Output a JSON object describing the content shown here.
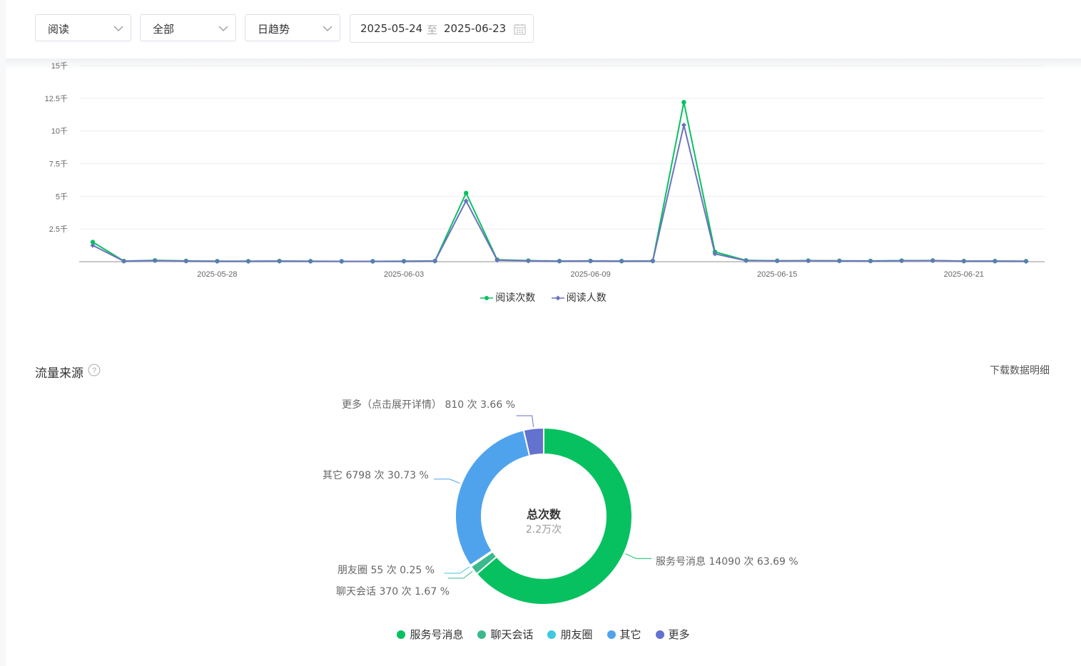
{
  "filters": {
    "metric": "阅读",
    "scope": "全部",
    "granularity": "日趋势",
    "date_start": "2025-05-24",
    "date_sep": "至",
    "date_end": "2025-06-23"
  },
  "trend_legend": [
    {
      "label": "阅读次数",
      "color": "#07c160"
    },
    {
      "label": "阅读人数",
      "color": "#6b72bd"
    }
  ],
  "chart_data": [
    {
      "type": "line",
      "x_start": "2025-05-24",
      "x_end": "2025-06-23",
      "xticks": [
        "2025-05-28",
        "2025-06-03",
        "2025-06-09",
        "2025-06-15",
        "2025-06-21"
      ],
      "yticks": [
        "2.5千",
        "5千",
        "7.5千",
        "10千",
        "12.5千",
        "15千"
      ],
      "ylim": [
        0,
        15000
      ],
      "grid": true,
      "legend": "bottom",
      "series": [
        {
          "name": "阅读次数",
          "color": "#07c160",
          "values": [
            1500,
            50,
            100,
            60,
            40,
            40,
            50,
            40,
            30,
            30,
            40,
            60,
            5250,
            150,
            80,
            50,
            60,
            50,
            60,
            12200,
            750,
            100,
            70,
            80,
            70,
            60,
            80,
            90,
            50,
            50,
            40
          ]
        },
        {
          "name": "阅读人数",
          "color": "#6b72bd",
          "values": [
            1250,
            40,
            80,
            50,
            30,
            30,
            40,
            30,
            25,
            25,
            30,
            50,
            4650,
            120,
            60,
            40,
            50,
            40,
            50,
            10450,
            600,
            80,
            60,
            70,
            60,
            50,
            70,
            80,
            40,
            40,
            30
          ]
        }
      ]
    },
    {
      "type": "pie",
      "title": "总次数",
      "total_label": "2.2万次",
      "legend": "bottom",
      "slices": [
        {
          "name": "服务号消息",
          "value": 14090,
          "percent": 63.69,
          "color": "#07c160"
        },
        {
          "name": "聊天会话",
          "value": 370,
          "percent": 1.67,
          "color": "#3cb98b"
        },
        {
          "name": "朋友圈",
          "value": 55,
          "percent": 0.25,
          "color": "#3ec9e0"
        },
        {
          "name": "其它",
          "value": 6798,
          "percent": 30.73,
          "color": "#4fa3ec"
        },
        {
          "name": "更多",
          "value": 810,
          "percent": 3.66,
          "color": "#6371cf"
        }
      ]
    }
  ],
  "traffic": {
    "title": "流量来源",
    "download": "下载数据明细",
    "labels": {
      "more": "更多（点击展开详情） 810 次 3.66 %",
      "other": "其它 6798 次 30.73 %",
      "moments": "朋友圈 55 次 0.25 %",
      "chat": "聊天会话 370 次 1.67 %",
      "service": "服务号消息 14090 次 63.69 %"
    }
  }
}
